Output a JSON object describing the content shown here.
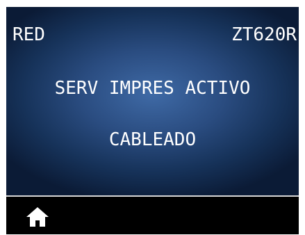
{
  "header": {
    "menu_title": "RED",
    "printer_model": "ZT620R"
  },
  "message": {
    "line1": "SERV IMPRES ACTIVO",
    "line2": "CABLEADO"
  },
  "footer": {
    "home_icon": "home-icon"
  },
  "colors": {
    "background": "#000000",
    "gradient_center": "#3f6aa6",
    "gradient_edge": "#0b1b36",
    "text": "#ffffff",
    "divider": "#d8d8d8"
  }
}
